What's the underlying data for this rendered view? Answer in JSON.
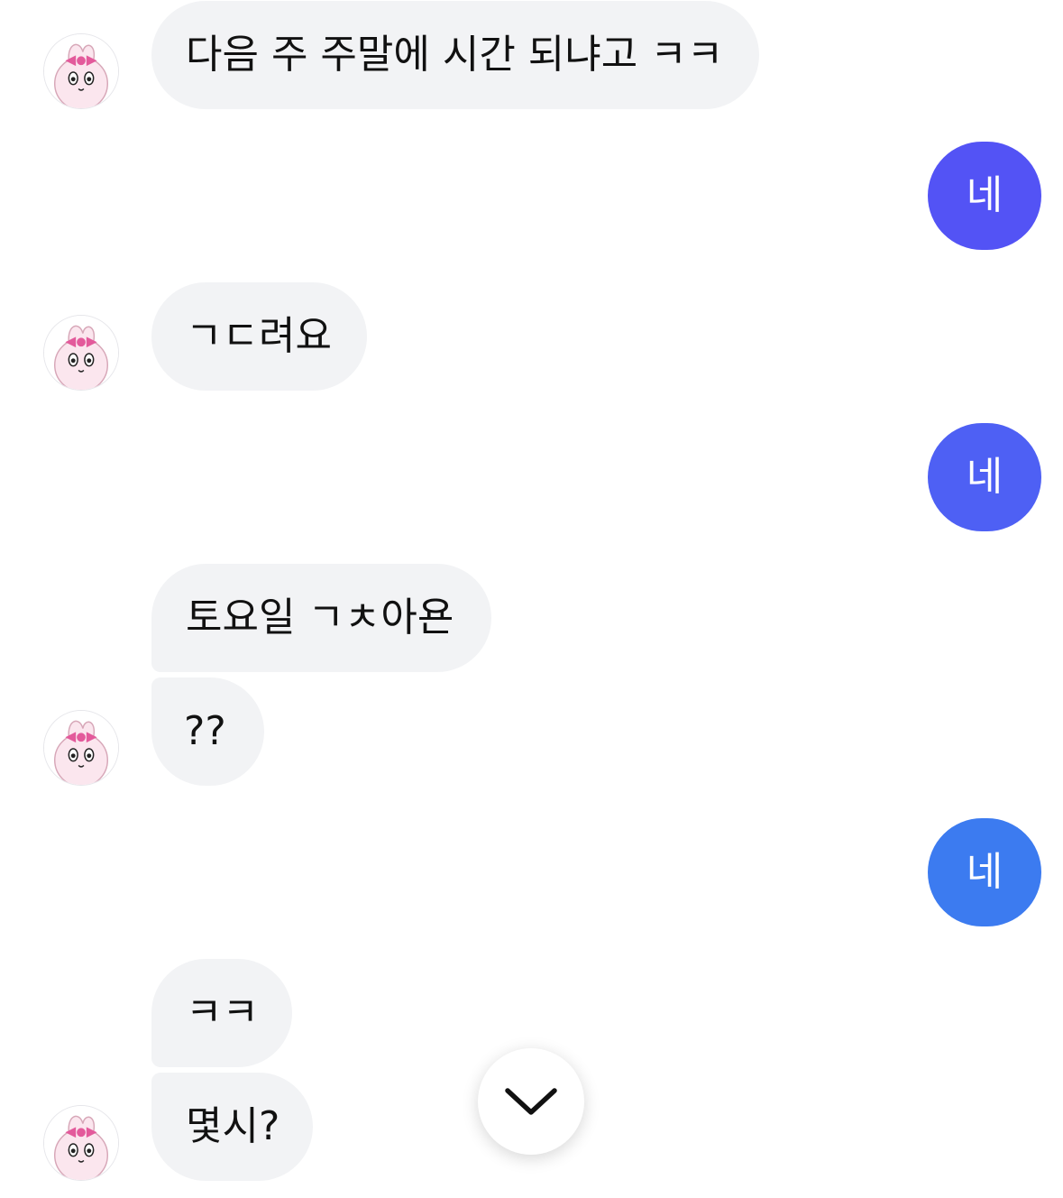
{
  "colors": {
    "incoming_bg": "#f2f3f5",
    "incoming_text": "#111111",
    "outgoing_text": "#ffffff",
    "outgoing_gradient": [
      "#5353f5",
      "#4e60f4",
      "#3c7bf0"
    ]
  },
  "messages": [
    {
      "direction": "in",
      "text": "다음 주 주말에 시간 되냐고 ㅋㅋ",
      "avatar": "pink-bunny-avatar"
    },
    {
      "direction": "out",
      "text": "네"
    },
    {
      "direction": "in",
      "text": "ㄱㄷ려요",
      "avatar": "pink-bunny-avatar"
    },
    {
      "direction": "out",
      "text": "네"
    },
    {
      "direction": "in",
      "text": "토요일 ㄱㅊ아욘"
    },
    {
      "direction": "in",
      "text": "??",
      "avatar": "pink-bunny-avatar"
    },
    {
      "direction": "out",
      "text": "네"
    },
    {
      "direction": "in",
      "text": "ㅋㅋ"
    },
    {
      "direction": "in",
      "text": "몇시?",
      "avatar": "pink-bunny-avatar"
    }
  ],
  "scroll_down_button": {
    "icon": "chevron-down-icon"
  }
}
